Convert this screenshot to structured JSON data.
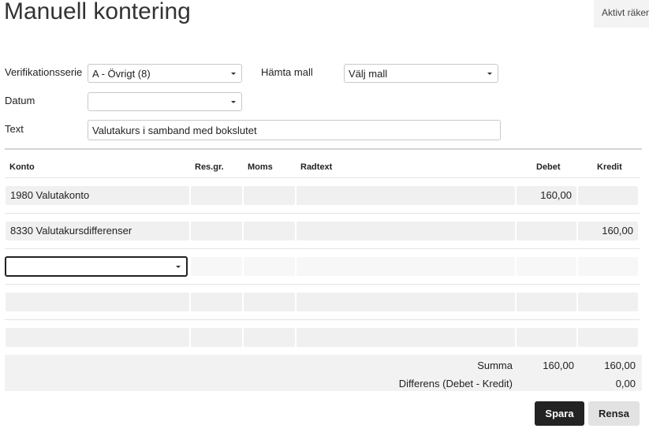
{
  "page": {
    "title": "Manuell kontering",
    "fiscal_year_button": "Aktivt räkenskapsår"
  },
  "form": {
    "series_label": "Verifikationsserie",
    "series_value": "A - Övrigt (8)",
    "template_label": "Hämta mall",
    "template_value": "Välj mall",
    "date_label": "Datum",
    "date_value": "",
    "text_label": "Text",
    "text_value": "Valutakurs i samband med bokslutet"
  },
  "table": {
    "headers": {
      "account": "Konto",
      "result_unit": "Res.gr.",
      "vat": "Moms",
      "row_text": "Radtext",
      "debit": "Debet",
      "credit": "Kredit"
    },
    "rows": [
      {
        "account": "1980 Valutakonto",
        "result_unit": "",
        "vat": "",
        "row_text": "",
        "debit": "160,00",
        "credit": ""
      },
      {
        "account": "8330 Valutakursdifferenser",
        "result_unit": "",
        "vat": "",
        "row_text": "",
        "debit": "",
        "credit": "160,00"
      }
    ]
  },
  "summary": {
    "sum_label": "Summa",
    "sum_debit": "160,00",
    "sum_credit": "160,00",
    "diff_label": "Differens (Debet - Kredit)",
    "diff_value": "0,00"
  },
  "buttons": {
    "save": "Spara",
    "clear": "Rensa"
  }
}
